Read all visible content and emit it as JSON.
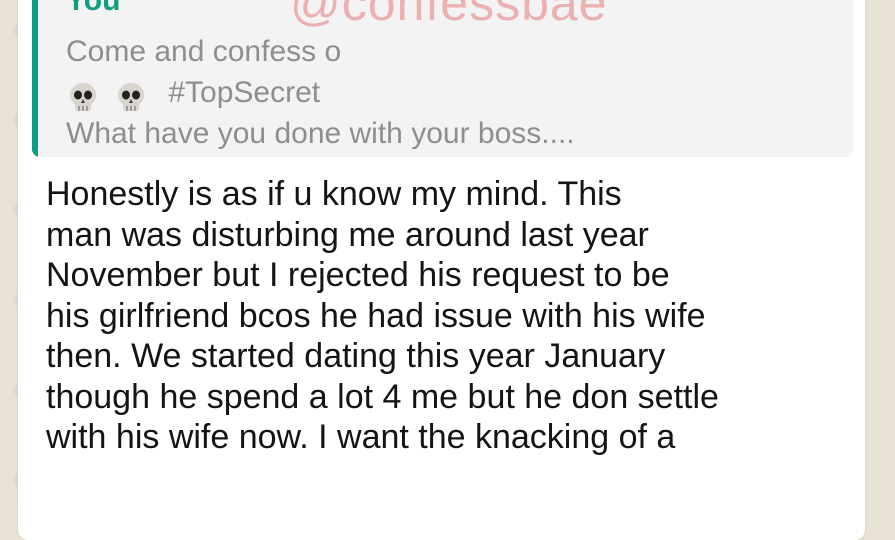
{
  "watermark": "@confessbae",
  "quoted_message": {
    "author": "You",
    "lines": [
      "Come and confess o",
      "#TopSecret",
      "What have you done with your boss...."
    ],
    "emoji": [
      "skull-emoji",
      "skull-emoji"
    ]
  },
  "message": {
    "lines": [
      "Honestly is as if u know my mind. This",
      "man was disturbing me around last year",
      "November but I rejected his request to be",
      "his girlfriend bcos he had issue with his wife",
      "then. We started dating this year January",
      "though he spend a lot 4 me but he don settle",
      "with his wife now. I want the knacking of a"
    ]
  },
  "colors": {
    "accent": "#0f9e82",
    "quote_background": "#f3f3f3",
    "bubble": "#ffffff",
    "wallpaper": "#e8e2d5",
    "watermark": "#e67878"
  }
}
